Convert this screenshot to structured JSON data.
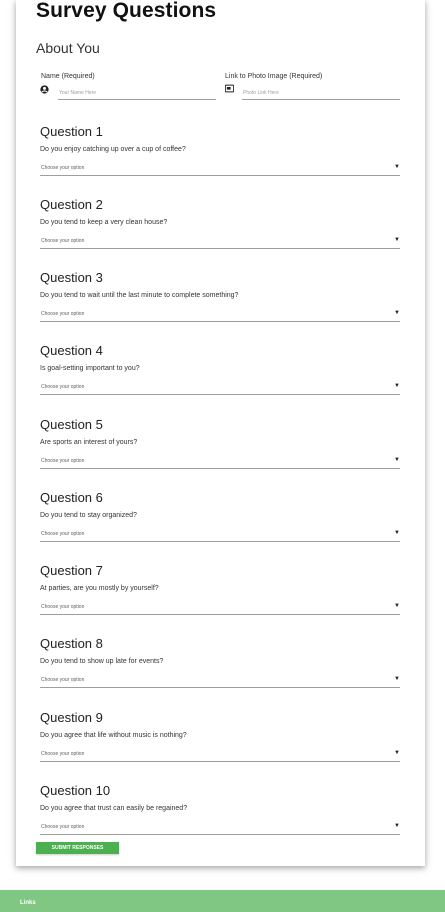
{
  "page": {
    "title": "Survey Questions",
    "subtitle": "About You"
  },
  "about_you": {
    "name_label": "Name (Required)",
    "name_placeholder": "Your Name Here",
    "name_icon": "account-circle-icon",
    "photo_label": "Link to Photo Image (Required)",
    "photo_placeholder": "Photo Link Here",
    "photo_icon": "picture-icon"
  },
  "questions": [
    {
      "heading": "Question 1",
      "text": "Do you enjoy catching up over a cup of coffee?",
      "selected": "Choose your option"
    },
    {
      "heading": "Question 2",
      "text": "Do you tend to keep a very clean house?",
      "selected": "Choose your option"
    },
    {
      "heading": "Question 3",
      "text": "Do you tend to wait until the last minute to complete something?",
      "selected": "Choose your option"
    },
    {
      "heading": "Question 4",
      "text": "Is goal-setting important to you?",
      "selected": "Choose your option"
    },
    {
      "heading": "Question 5",
      "text": "Are sports an interest of yours?",
      "selected": "Choose your option"
    },
    {
      "heading": "Question 6",
      "text": "Do you tend to stay organized?",
      "selected": "Choose your option"
    },
    {
      "heading": "Question 7",
      "text": "At parties, are you mostly by yourself?",
      "selected": "Choose your option"
    },
    {
      "heading": "Question 8",
      "text": "Do you tend to show up late for events?",
      "selected": "Choose your option"
    },
    {
      "heading": "Question 9",
      "text": "Do you agree that life without music is nothing?",
      "selected": "Choose your option"
    },
    {
      "heading": "Question 10",
      "text": "Do you agree that trust can easily be regained?",
      "selected": "Choose your option"
    }
  ],
  "submit_label": "SUBMIT RESPONSES",
  "footer": {
    "title": "Links"
  },
  "colors": {
    "submit": "#4caf50",
    "footer": "#81c784"
  }
}
